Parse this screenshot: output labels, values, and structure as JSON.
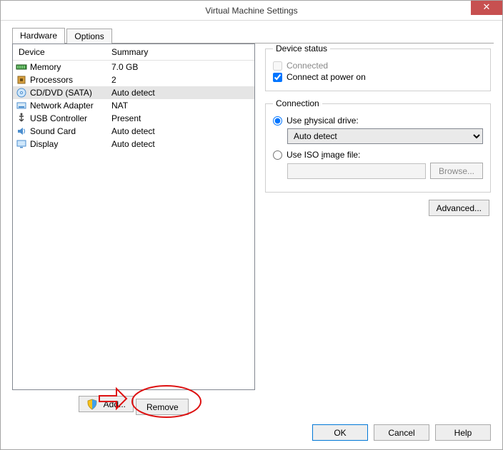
{
  "window": {
    "title": "Virtual Machine Settings"
  },
  "tabs": {
    "hardware": "Hardware",
    "options": "Options",
    "active": "hardware"
  },
  "headers": {
    "device": "Device",
    "summary": "Summary"
  },
  "devices": [
    {
      "name": "Memory",
      "summary": "7.0 GB",
      "icon": "memory",
      "selected": false
    },
    {
      "name": "Processors",
      "summary": "2",
      "icon": "cpu",
      "selected": false
    },
    {
      "name": "CD/DVD (SATA)",
      "summary": "Auto detect",
      "icon": "disc",
      "selected": true
    },
    {
      "name": "Network Adapter",
      "summary": "NAT",
      "icon": "nic",
      "selected": false
    },
    {
      "name": "USB Controller",
      "summary": "Present",
      "icon": "usb",
      "selected": false
    },
    {
      "name": "Sound Card",
      "summary": "Auto detect",
      "icon": "sound",
      "selected": false
    },
    {
      "name": "Display",
      "summary": "Auto detect",
      "icon": "display",
      "selected": false
    }
  ],
  "left_buttons": {
    "add": "Add...",
    "remove": "Remove"
  },
  "device_status": {
    "legend": "Device status",
    "connected_label": "Connected",
    "connected_checked": false,
    "connected_enabled": false,
    "power_on_label": "Connect at power on",
    "power_on_checked": true
  },
  "connection": {
    "legend": "Connection",
    "use_physical_label_pre": "Use ",
    "use_physical_label_key": "p",
    "use_physical_label_post": "hysical drive:",
    "physical_selected": true,
    "physical_value": "Auto detect",
    "use_iso_label_pre": "Use ISO ",
    "use_iso_label_key": "i",
    "use_iso_label_post": "mage file:",
    "iso_selected": false,
    "iso_path": "",
    "browse_label": "Browse..."
  },
  "advanced": {
    "label": "Advanced..."
  },
  "footer": {
    "ok": "OK",
    "cancel": "Cancel",
    "help": "Help"
  }
}
